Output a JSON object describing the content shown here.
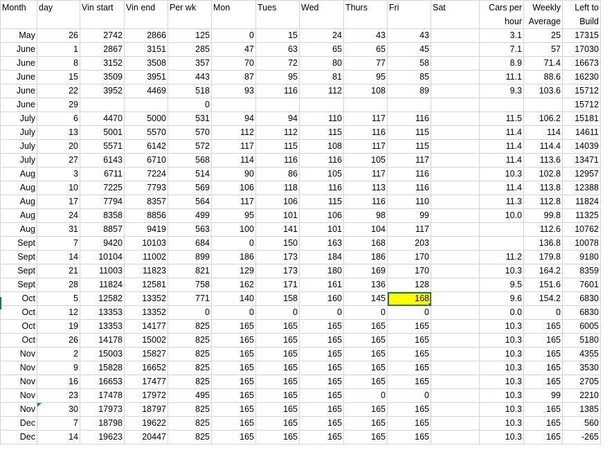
{
  "sheet": {
    "headers": [
      [
        "Month",
        ""
      ],
      [
        "day",
        ""
      ],
      [
        "Vin start",
        ""
      ],
      [
        "Vin end",
        ""
      ],
      [
        "Per wk",
        ""
      ],
      [
        "Mon",
        ""
      ],
      [
        "Tues",
        ""
      ],
      [
        "Wed",
        ""
      ],
      [
        "Thurs",
        ""
      ],
      [
        "Fri",
        ""
      ],
      [
        "Sat",
        ""
      ],
      [
        "Cars per",
        "hour"
      ],
      [
        "Weekly",
        "Average"
      ],
      [
        "Left to",
        "Build"
      ]
    ],
    "rows": [
      [
        "May",
        "26",
        "2742",
        "2866",
        "125",
        "0",
        "15",
        "24",
        "43",
        "43",
        "",
        "3.1",
        "25",
        "17315"
      ],
      [
        "June",
        "1",
        "2867",
        "3151",
        "285",
        "47",
        "63",
        "65",
        "65",
        "45",
        "",
        "7.1",
        "57",
        "17030"
      ],
      [
        "June",
        "8",
        "3152",
        "3508",
        "357",
        "70",
        "72",
        "80",
        "77",
        "58",
        "",
        "8.9",
        "71.4",
        "16673"
      ],
      [
        "June",
        "15",
        "3509",
        "3951",
        "443",
        "87",
        "95",
        "81",
        "95",
        "85",
        "",
        "11.1",
        "88.6",
        "16230"
      ],
      [
        "June",
        "22",
        "3952",
        "4469",
        "518",
        "93",
        "116",
        "112",
        "108",
        "89",
        "",
        "9.3",
        "103.6",
        "15712"
      ],
      [
        "June",
        "29",
        "",
        "",
        "0",
        "",
        "",
        "",
        "",
        "",
        "",
        "",
        "",
        "15712"
      ],
      [
        "July",
        "6",
        "4470",
        "5000",
        "531",
        "94",
        "94",
        "110",
        "117",
        "116",
        "",
        "11.5",
        "106.2",
        "15181"
      ],
      [
        "July",
        "13",
        "5001",
        "5570",
        "570",
        "112",
        "112",
        "115",
        "116",
        "115",
        "",
        "11.4",
        "114",
        "14611"
      ],
      [
        "July",
        "20",
        "5571",
        "6142",
        "572",
        "117",
        "115",
        "108",
        "117",
        "115",
        "",
        "11.4",
        "114.4",
        "14039"
      ],
      [
        "July",
        "27",
        "6143",
        "6710",
        "568",
        "114",
        "116",
        "116",
        "105",
        "117",
        "",
        "11.4",
        "113.6",
        "13471"
      ],
      [
        "Aug",
        "3",
        "6711",
        "7224",
        "514",
        "90",
        "86",
        "105",
        "117",
        "116",
        "",
        "10.3",
        "102.8",
        "12957"
      ],
      [
        "Aug",
        "10",
        "7225",
        "7793",
        "569",
        "106",
        "118",
        "116",
        "113",
        "116",
        "",
        "11.4",
        "113.8",
        "12388"
      ],
      [
        "Aug",
        "17",
        "7794",
        "8357",
        "564",
        "117",
        "106",
        "115",
        "116",
        "110",
        "",
        "11.3",
        "112.8",
        "11824"
      ],
      [
        "Aug",
        "24",
        "8358",
        "8856",
        "499",
        "95",
        "101",
        "106",
        "98",
        "99",
        "",
        "10.0",
        "99.8",
        "11325"
      ],
      [
        "Aug",
        "31",
        "8857",
        "9419",
        "563",
        "100",
        "141",
        "101",
        "104",
        "117",
        "",
        "",
        "112.6",
        "10762"
      ],
      [
        "Sept",
        "7",
        "9420",
        "10103",
        "684",
        "0",
        "150",
        "163",
        "168",
        "203",
        "",
        "",
        "136.8",
        "10078"
      ],
      [
        "Sept",
        "14",
        "10104",
        "11002",
        "899",
        "186",
        "173",
        "184",
        "186",
        "170",
        "",
        "11.2",
        "179.8",
        "9180"
      ],
      [
        "Sept",
        "21",
        "11003",
        "11823",
        "821",
        "129",
        "173",
        "180",
        "169",
        "170",
        "",
        "10.3",
        "164.2",
        "8359"
      ],
      [
        "Sept",
        "28",
        "11824",
        "12581",
        "758",
        "162",
        "171",
        "161",
        "136",
        "128",
        "",
        "9.5",
        "151.6",
        "7601"
      ],
      [
        "Oct",
        "5",
        "12582",
        "13352",
        "771",
        "140",
        "158",
        "160",
        "145",
        "168",
        "",
        "9.6",
        "154.2",
        "6830"
      ],
      [
        "Oct",
        "12",
        "13353",
        "13352",
        "0",
        "0",
        "0",
        "0",
        "0",
        "0",
        "",
        "0.0",
        "0",
        "6830"
      ],
      [
        "Oct",
        "19",
        "13353",
        "14177",
        "825",
        "165",
        "165",
        "165",
        "165",
        "165",
        "",
        "10.3",
        "165",
        "6005"
      ],
      [
        "Oct",
        "26",
        "14178",
        "15002",
        "825",
        "165",
        "165",
        "165",
        "165",
        "165",
        "",
        "10.3",
        "165",
        "5180"
      ],
      [
        "Nov",
        "2",
        "15003",
        "15827",
        "825",
        "165",
        "165",
        "165",
        "165",
        "165",
        "",
        "10.3",
        "165",
        "4355"
      ],
      [
        "Nov",
        "9",
        "15828",
        "16652",
        "825",
        "165",
        "165",
        "165",
        "165",
        "165",
        "",
        "10.3",
        "165",
        "3530"
      ],
      [
        "Nov",
        "16",
        "16653",
        "17477",
        "825",
        "165",
        "165",
        "165",
        "165",
        "165",
        "",
        "10.3",
        "165",
        "2705"
      ],
      [
        "Nov",
        "23",
        "17478",
        "17972",
        "495",
        "165",
        "165",
        "165",
        "0",
        "0",
        "",
        "10.3",
        "99",
        "2210"
      ],
      [
        "Nov",
        "30",
        "17973",
        "18797",
        "825",
        "165",
        "165",
        "165",
        "165",
        "165",
        "",
        "10.3",
        "165",
        "1385"
      ],
      [
        "Dec",
        "7",
        "18798",
        "19622",
        "825",
        "165",
        "165",
        "165",
        "165",
        "165",
        "",
        "10.3",
        "165",
        "560"
      ],
      [
        "Dec",
        "14",
        "19623",
        "20447",
        "825",
        "165",
        "165",
        "165",
        "165",
        "165",
        "",
        "10.3",
        "165",
        "-265"
      ]
    ],
    "selected_fill_color": "#ffff00",
    "selection_border_color": "#217346",
    "gridline_color": "#d4d4d4"
  }
}
